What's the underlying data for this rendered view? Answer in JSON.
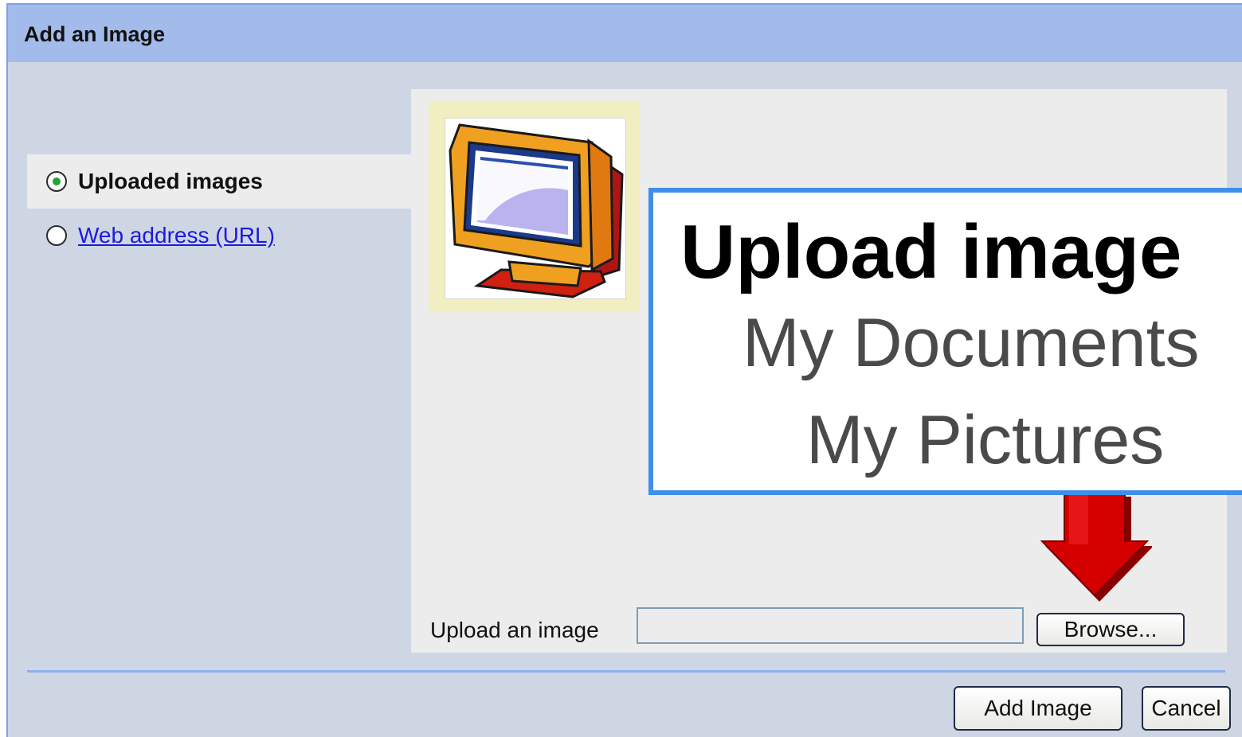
{
  "dialog": {
    "title": "Add an Image",
    "sources": [
      {
        "label": "Uploaded images",
        "selected": true
      },
      {
        "label": "Web address (URL)",
        "selected": false
      }
    ],
    "thumbnail_icon": "computer-monitor-icon",
    "upload_label": "Upload an image",
    "file_input_value": "",
    "browse_label": "Browse...",
    "add_image_label": "Add Image",
    "cancel_label": "Cancel"
  },
  "callout": {
    "title": "Upload image",
    "line1": "My Documents",
    "line2": "My Pictures"
  },
  "colors": {
    "titlebar": "#a2bbea",
    "dialog_bg": "#cfd6e3",
    "panel_bg": "#ececec",
    "callout_border": "#3f8fea",
    "arrow": "#cc0000"
  }
}
